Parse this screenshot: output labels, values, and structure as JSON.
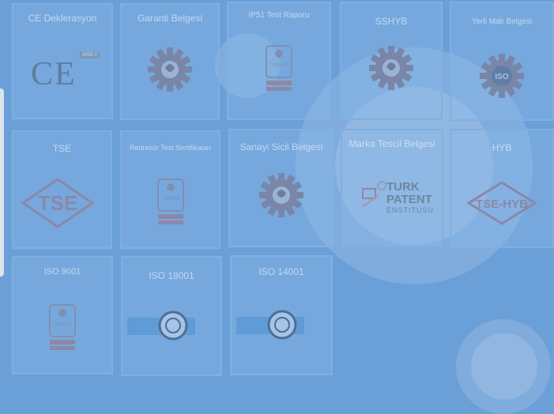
{
  "certificates": [
    {
      "title": "CE Deklerasyon",
      "icon": "ce-mark-icon"
    },
    {
      "title": "Garanti Belgesi",
      "icon": "gear-certificate-icon"
    },
    {
      "title": "IP51 Test Raporu",
      "icon": "turkak-badge-icon"
    },
    {
      "title": "SSHYB",
      "icon": "gear-certificate-icon"
    },
    {
      "title": "Yerli Malı Belgesi",
      "icon": "iso-gear-icon"
    },
    {
      "title": "TSE",
      "icon": "tse-diamond-icon"
    },
    {
      "title": "Redresör Test Sertifikaları",
      "icon": "turkak-badge-icon"
    },
    {
      "title": "Sanayi Sicil Belgesi",
      "icon": "gear-certificate-icon"
    },
    {
      "title": "Marka Tescil Belgesi",
      "icon": "turk-patent-icon"
    },
    {
      "title": "HYB",
      "icon": "tse-hyb-diamond-icon"
    },
    {
      "title": "ISO 9001",
      "icon": "turkak-badge-icon"
    },
    {
      "title": "ISO 18001",
      "icon": "iso-seal-banner-icon"
    },
    {
      "title": "ISO 14001",
      "icon": "iso-seal-banner-icon"
    }
  ],
  "logos": {
    "ce_text": "CE",
    "ce_tag": "9999-0",
    "tse": "TSE",
    "tse_hyb": "TSE-HYB",
    "iso": "ISO",
    "turkak": "TÜRKAK",
    "turk_patent_line1": "TURK",
    "turk_patent_line2": "PATENT",
    "turk_patent_line3": "ENSTITUSU"
  },
  "colors": {
    "background": "#6a9fd8",
    "card_border": "#7fb0e3",
    "logo_muted": "#6d86a3"
  }
}
